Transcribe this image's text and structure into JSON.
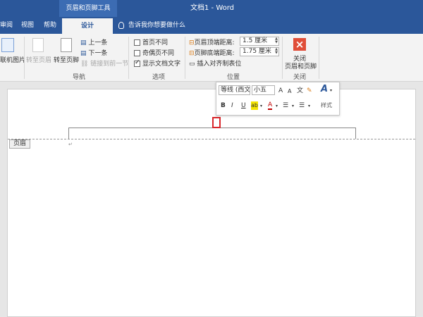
{
  "titlebar": {
    "context_tab": "页眉和页脚工具",
    "doc_title": "文档1 - Word"
  },
  "tabs": {
    "review": "审阅",
    "view": "视图",
    "help": "帮助",
    "design": "设计",
    "tell_me": "告诉我你想要做什么"
  },
  "ribbon": {
    "insert": {
      "online_pictures": "联机图片"
    },
    "nav": {
      "goto_header": "转至页眉",
      "goto_footer": "转至页脚",
      "previous": "上一条",
      "next": "下一条",
      "link_prev": "链接到前一节",
      "group_label": "导航"
    },
    "options": {
      "diff_first": "首页不同",
      "diff_odd_even": "奇偶页不同",
      "show_doc_text": "显示文档文字",
      "show_doc_text_checked": true,
      "group_label": "选项"
    },
    "position": {
      "header_top_label": "页眉顶端距离:",
      "header_top_value": "1.5 厘米",
      "footer_bottom_label": "页脚底端距离:",
      "footer_bottom_value": "1.75 厘米",
      "insert_align_tab": "插入对齐制表位",
      "group_label": "位置"
    },
    "close": {
      "button_label_1": "关闭",
      "button_label_2": "页眉和页脚",
      "group_label": "关闭"
    }
  },
  "mini_toolbar": {
    "font": "等线 (西文",
    "size": "小五",
    "grow": "A",
    "shrink": "A",
    "pinyin": "文",
    "bold": "B",
    "italic": "I",
    "underline": "U",
    "highlight": "ab",
    "font_color": "A",
    "styles": "样式",
    "styles_glyph": "A"
  },
  "document": {
    "header_tag": "页眉",
    "para_mark": "↵"
  },
  "colors": {
    "word_blue": "#2b579a",
    "close_red": "#e04e39",
    "highlight_box": "#d9262b"
  }
}
